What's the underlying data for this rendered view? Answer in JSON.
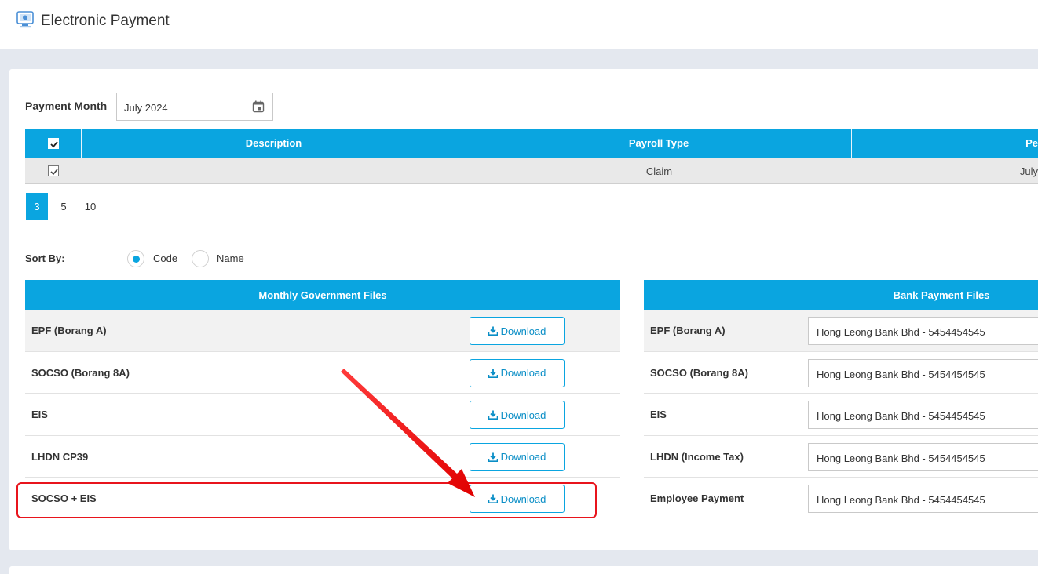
{
  "header": {
    "title": "Electronic Payment",
    "icon": "payment-monitor-icon"
  },
  "payment_month": {
    "label": "Payment Month",
    "value": "July 2024",
    "icon": "calendar-icon"
  },
  "grid": {
    "columns": [
      "Description",
      "Payroll Type",
      "Pe"
    ],
    "rows": [
      {
        "description": "",
        "payroll_type": "Claim",
        "period": "July"
      }
    ]
  },
  "pager": {
    "sizes": [
      "3",
      "5",
      "10"
    ],
    "active": "3"
  },
  "sort": {
    "label": "Sort By:",
    "options": [
      "Code",
      "Name"
    ],
    "selected": "Code"
  },
  "gov_files": {
    "title": "Monthly Government Files",
    "download_label": "Download",
    "items": [
      "EPF (Borang A)",
      "SOCSO (Borang 8A)",
      "EIS",
      "LHDN CP39",
      "SOCSO + EIS"
    ]
  },
  "bank_files": {
    "title": "Bank Payment Files",
    "items": [
      {
        "label": "EPF (Borang A)",
        "bank": "Hong Leong Bank Bhd - 5454454545"
      },
      {
        "label": "SOCSO (Borang 8A)",
        "bank": "Hong Leong Bank Bhd - 5454454545"
      },
      {
        "label": "EIS",
        "bank": "Hong Leong Bank Bhd - 5454454545"
      },
      {
        "label": "LHDN (Income Tax)",
        "bank": "Hong Leong Bank Bhd - 5454454545"
      },
      {
        "label": "Employee Payment",
        "bank": "Hong Leong Bank Bhd - 5454454545"
      }
    ]
  },
  "colors": {
    "accent": "#0aa5e0",
    "highlight": "#e8141c"
  }
}
